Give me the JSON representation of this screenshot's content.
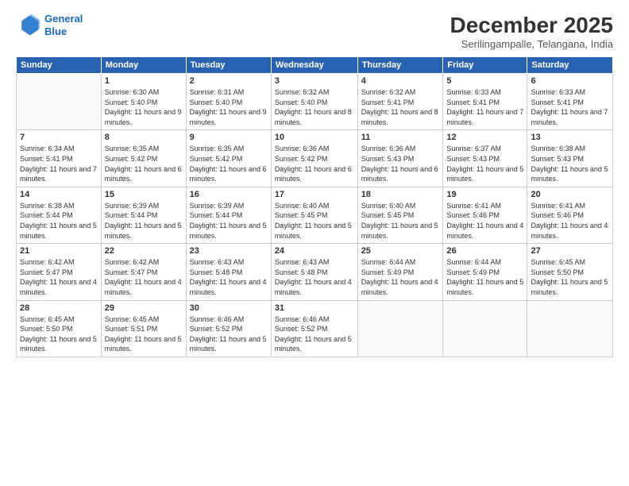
{
  "header": {
    "logo": {
      "line1": "General",
      "line2": "Blue"
    },
    "title": "December 2025",
    "subtitle": "Serilingampalle, Telangana, India"
  },
  "days_of_week": [
    "Sunday",
    "Monday",
    "Tuesday",
    "Wednesday",
    "Thursday",
    "Friday",
    "Saturday"
  ],
  "weeks": [
    [
      {
        "day": "",
        "sunrise": "",
        "sunset": "",
        "daylight": ""
      },
      {
        "day": "1",
        "sunrise": "Sunrise: 6:30 AM",
        "sunset": "Sunset: 5:40 PM",
        "daylight": "Daylight: 11 hours and 9 minutes."
      },
      {
        "day": "2",
        "sunrise": "Sunrise: 6:31 AM",
        "sunset": "Sunset: 5:40 PM",
        "daylight": "Daylight: 11 hours and 9 minutes."
      },
      {
        "day": "3",
        "sunrise": "Sunrise: 6:32 AM",
        "sunset": "Sunset: 5:40 PM",
        "daylight": "Daylight: 11 hours and 8 minutes."
      },
      {
        "day": "4",
        "sunrise": "Sunrise: 6:32 AM",
        "sunset": "Sunset: 5:41 PM",
        "daylight": "Daylight: 11 hours and 8 minutes."
      },
      {
        "day": "5",
        "sunrise": "Sunrise: 6:33 AM",
        "sunset": "Sunset: 5:41 PM",
        "daylight": "Daylight: 11 hours and 7 minutes."
      },
      {
        "day": "6",
        "sunrise": "Sunrise: 6:33 AM",
        "sunset": "Sunset: 5:41 PM",
        "daylight": "Daylight: 11 hours and 7 minutes."
      }
    ],
    [
      {
        "day": "7",
        "sunrise": "Sunrise: 6:34 AM",
        "sunset": "Sunset: 5:41 PM",
        "daylight": "Daylight: 11 hours and 7 minutes."
      },
      {
        "day": "8",
        "sunrise": "Sunrise: 6:35 AM",
        "sunset": "Sunset: 5:42 PM",
        "daylight": "Daylight: 11 hours and 6 minutes."
      },
      {
        "day": "9",
        "sunrise": "Sunrise: 6:35 AM",
        "sunset": "Sunset: 5:42 PM",
        "daylight": "Daylight: 11 hours and 6 minutes."
      },
      {
        "day": "10",
        "sunrise": "Sunrise: 6:36 AM",
        "sunset": "Sunset: 5:42 PM",
        "daylight": "Daylight: 11 hours and 6 minutes."
      },
      {
        "day": "11",
        "sunrise": "Sunrise: 6:36 AM",
        "sunset": "Sunset: 5:43 PM",
        "daylight": "Daylight: 11 hours and 6 minutes."
      },
      {
        "day": "12",
        "sunrise": "Sunrise: 6:37 AM",
        "sunset": "Sunset: 5:43 PM",
        "daylight": "Daylight: 11 hours and 5 minutes."
      },
      {
        "day": "13",
        "sunrise": "Sunrise: 6:38 AM",
        "sunset": "Sunset: 5:43 PM",
        "daylight": "Daylight: 11 hours and 5 minutes."
      }
    ],
    [
      {
        "day": "14",
        "sunrise": "Sunrise: 6:38 AM",
        "sunset": "Sunset: 5:44 PM",
        "daylight": "Daylight: 11 hours and 5 minutes."
      },
      {
        "day": "15",
        "sunrise": "Sunrise: 6:39 AM",
        "sunset": "Sunset: 5:44 PM",
        "daylight": "Daylight: 11 hours and 5 minutes."
      },
      {
        "day": "16",
        "sunrise": "Sunrise: 6:39 AM",
        "sunset": "Sunset: 5:44 PM",
        "daylight": "Daylight: 11 hours and 5 minutes."
      },
      {
        "day": "17",
        "sunrise": "Sunrise: 6:40 AM",
        "sunset": "Sunset: 5:45 PM",
        "daylight": "Daylight: 11 hours and 5 minutes."
      },
      {
        "day": "18",
        "sunrise": "Sunrise: 6:40 AM",
        "sunset": "Sunset: 5:45 PM",
        "daylight": "Daylight: 11 hours and 5 minutes."
      },
      {
        "day": "19",
        "sunrise": "Sunrise: 6:41 AM",
        "sunset": "Sunset: 5:46 PM",
        "daylight": "Daylight: 11 hours and 4 minutes."
      },
      {
        "day": "20",
        "sunrise": "Sunrise: 6:41 AM",
        "sunset": "Sunset: 5:46 PM",
        "daylight": "Daylight: 11 hours and 4 minutes."
      }
    ],
    [
      {
        "day": "21",
        "sunrise": "Sunrise: 6:42 AM",
        "sunset": "Sunset: 5:47 PM",
        "daylight": "Daylight: 11 hours and 4 minutes."
      },
      {
        "day": "22",
        "sunrise": "Sunrise: 6:42 AM",
        "sunset": "Sunset: 5:47 PM",
        "daylight": "Daylight: 11 hours and 4 minutes."
      },
      {
        "day": "23",
        "sunrise": "Sunrise: 6:43 AM",
        "sunset": "Sunset: 5:48 PM",
        "daylight": "Daylight: 11 hours and 4 minutes."
      },
      {
        "day": "24",
        "sunrise": "Sunrise: 6:43 AM",
        "sunset": "Sunset: 5:48 PM",
        "daylight": "Daylight: 11 hours and 4 minutes."
      },
      {
        "day": "25",
        "sunrise": "Sunrise: 6:44 AM",
        "sunset": "Sunset: 5:49 PM",
        "daylight": "Daylight: 11 hours and 4 minutes."
      },
      {
        "day": "26",
        "sunrise": "Sunrise: 6:44 AM",
        "sunset": "Sunset: 5:49 PM",
        "daylight": "Daylight: 11 hours and 5 minutes."
      },
      {
        "day": "27",
        "sunrise": "Sunrise: 6:45 AM",
        "sunset": "Sunset: 5:50 PM",
        "daylight": "Daylight: 11 hours and 5 minutes."
      }
    ],
    [
      {
        "day": "28",
        "sunrise": "Sunrise: 6:45 AM",
        "sunset": "Sunset: 5:50 PM",
        "daylight": "Daylight: 11 hours and 5 minutes."
      },
      {
        "day": "29",
        "sunrise": "Sunrise: 6:45 AM",
        "sunset": "Sunset: 5:51 PM",
        "daylight": "Daylight: 11 hours and 5 minutes."
      },
      {
        "day": "30",
        "sunrise": "Sunrise: 6:46 AM",
        "sunset": "Sunset: 5:52 PM",
        "daylight": "Daylight: 11 hours and 5 minutes."
      },
      {
        "day": "31",
        "sunrise": "Sunrise: 6:46 AM",
        "sunset": "Sunset: 5:52 PM",
        "daylight": "Daylight: 11 hours and 5 minutes."
      },
      {
        "day": "",
        "sunrise": "",
        "sunset": "",
        "daylight": ""
      },
      {
        "day": "",
        "sunrise": "",
        "sunset": "",
        "daylight": ""
      },
      {
        "day": "",
        "sunrise": "",
        "sunset": "",
        "daylight": ""
      }
    ]
  ]
}
